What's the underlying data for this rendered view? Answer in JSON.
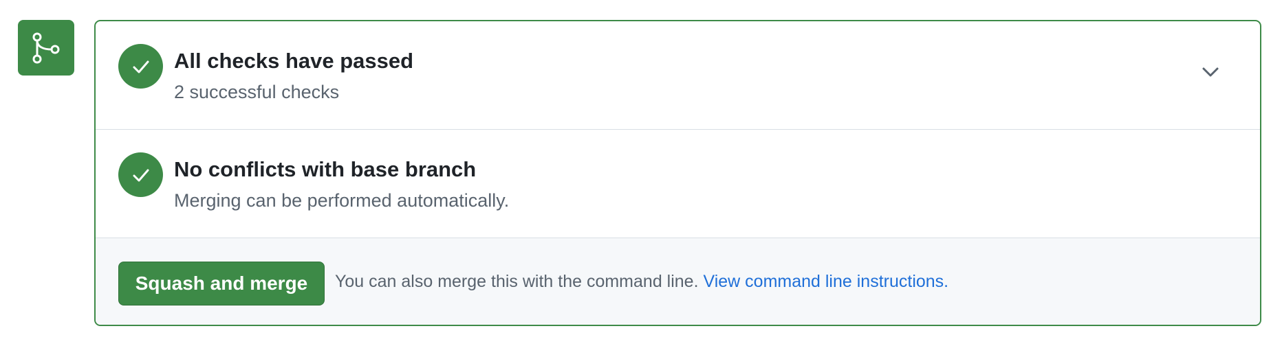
{
  "merge_icon": "git-merge-icon",
  "checks": {
    "icon": "check-icon",
    "title": "All checks have passed",
    "subtitle": "2 successful checks",
    "expand_icon": "chevron-down-icon"
  },
  "conflicts": {
    "icon": "check-icon",
    "title": "No conflicts with base branch",
    "subtitle": "Merging can be performed automatically."
  },
  "action": {
    "button_label": "Squash and merge",
    "text": "You can also merge this with the command line.",
    "link_text": "View command line instructions."
  },
  "colors": {
    "success": "#3d8a47",
    "link": "#1f6fd8",
    "muted_text": "#59636e",
    "title_text": "#1f2328",
    "action_bg": "#f6f8fa"
  }
}
